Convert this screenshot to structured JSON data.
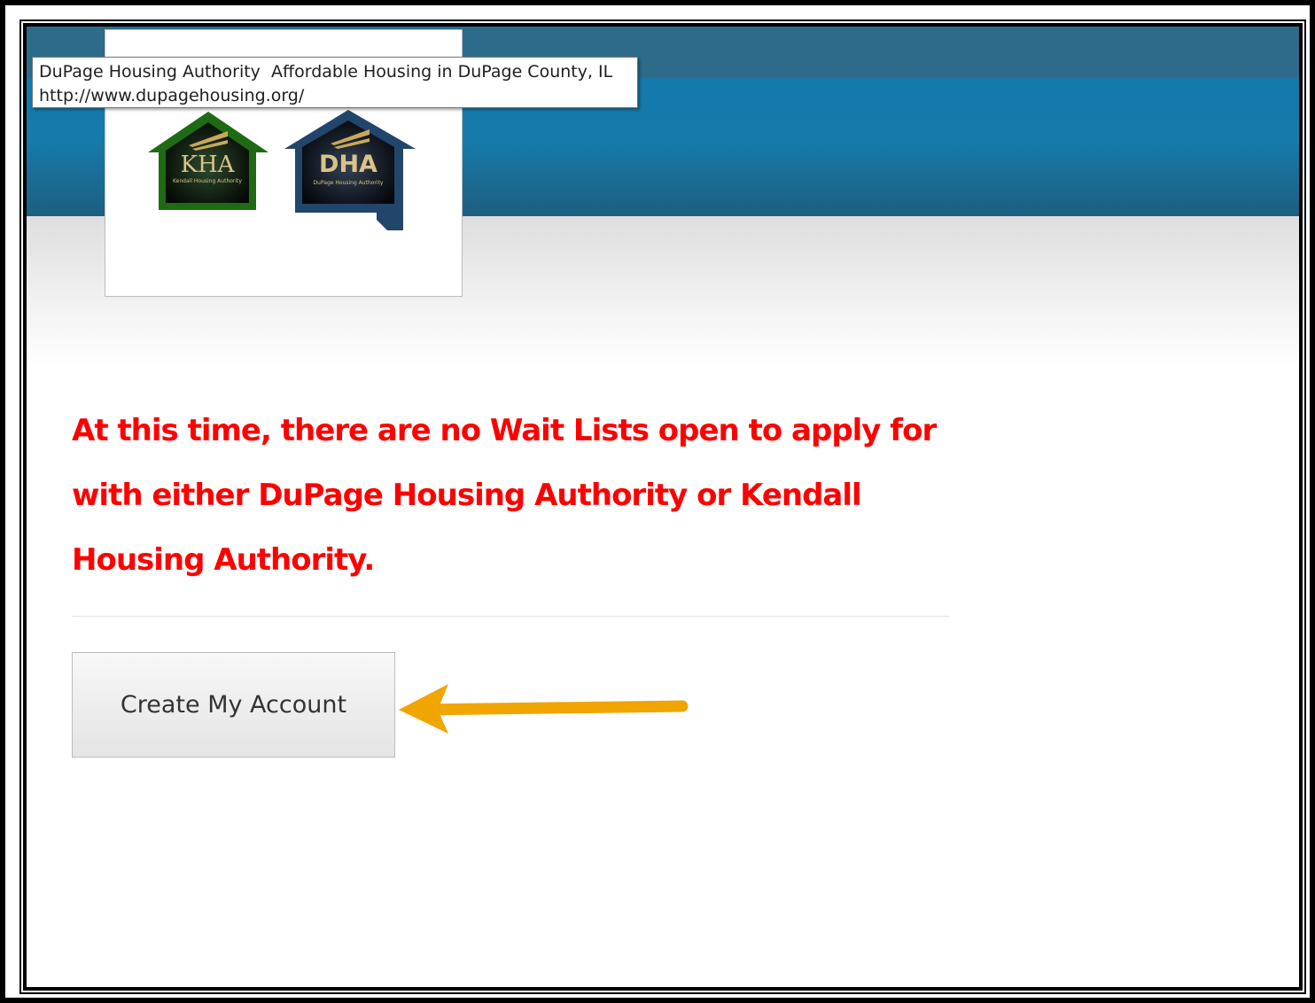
{
  "tooltip": {
    "title": "DuPage Housing Authority  Affordable Housing in DuPage County, IL",
    "url": "http://www.dupagehousing.org/"
  },
  "logos": {
    "kha": {
      "abbr": "KHA",
      "name": "Kendall Housing Authority",
      "color": "#1a5c14"
    },
    "dha": {
      "abbr": "DHA",
      "name": "DuPage Housing Authority",
      "color": "#22456b"
    }
  },
  "main": {
    "message": "At this time, there are no Wait Lists open to apply for with either DuPage Housing Authority or Kendall Housing Authority.",
    "create_account_label": "Create My Account"
  },
  "colors": {
    "header_blue": "#167aaa",
    "message_red": "#ff0000",
    "arrow_orange": "#f0a500"
  },
  "icons": {
    "arrow": "arrow-left-icon"
  }
}
